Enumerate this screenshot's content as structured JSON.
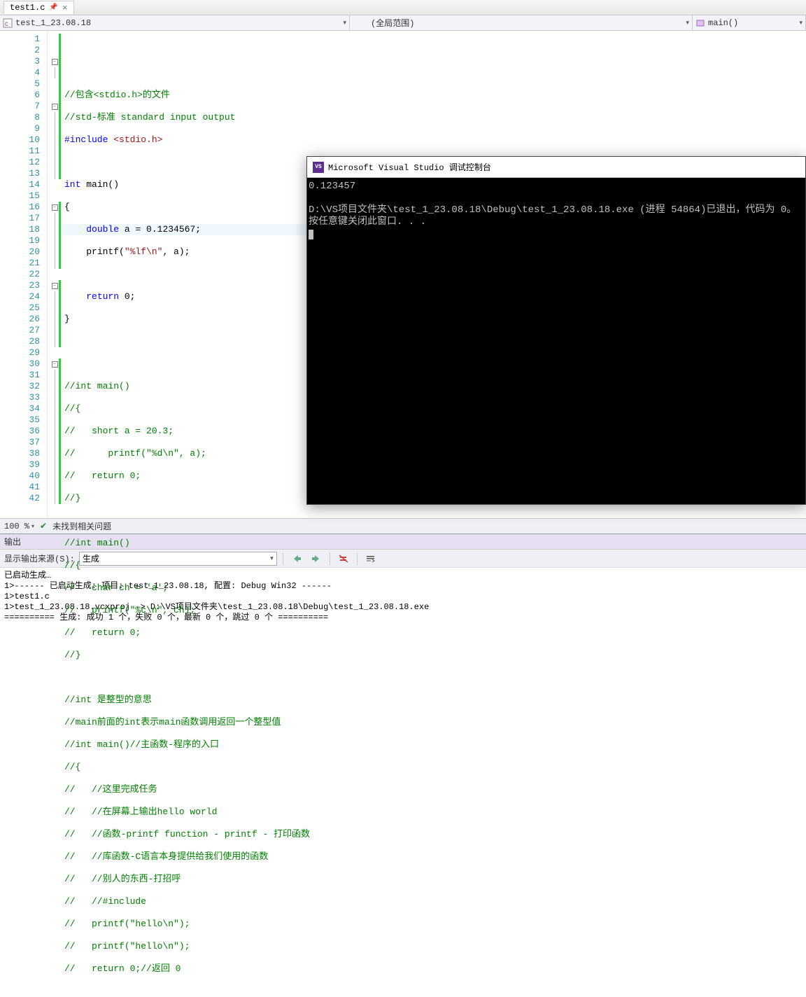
{
  "tab": {
    "filename": "test1.c"
  },
  "nav": {
    "file": "test_1_23.08.18",
    "scope": "(全局范围)",
    "func": "main()"
  },
  "code": {
    "lines": [
      "",
      "",
      "//包含<stdio.h>的文件",
      "//std-标准 standard input output",
      "#include <stdio.h>",
      "",
      "int main()",
      "{",
      "    double a = 0.1234567;",
      "    printf(\"%lf\\n\", a);",
      "",
      "    return 0;",
      "}",
      "",
      "",
      "//int main()",
      "//{",
      "//   short a = 20.3;",
      "//      printf(\"%d\\n\", a);",
      "//   return 0;",
      "//}",
      "",
      "//int main()",
      "//{",
      "//   char ch = 'a';",
      "//   printf(\"%c\\n\", ch);",
      "//   return 0;",
      "//}",
      "",
      "//int 是整型的意思",
      "//main前面的int表示main函数调用返回一个整型值",
      "//int main()//主函数-程序的入口",
      "//{",
      "//   //这里完成任务",
      "//   //在屏幕上输出hello world",
      "//   //函数-printf function - printf - 打印函数",
      "//   //库函数-C语言本身提供给我们使用的函数",
      "//   //别人的东西-打招呼",
      "//   //#include",
      "//   printf(\"hello\\n\");",
      "//   printf(\"hello\\n\");",
      "//   return 0;//返回 0"
    ]
  },
  "status": {
    "zoom": "100 %",
    "issues": "未找到相关问题"
  },
  "output": {
    "panel_title": "输出",
    "source_label": "显示输出来源(S):",
    "source_value": "生成",
    "body": "已启动生成…\n1>------ 已启动生成: 项目: test_1_23.08.18, 配置: Debug Win32 ------\n1>test1.c\n1>test_1_23.08.18.vcxproj -> D:\\VS项目文件夹\\test_1_23.08.18\\Debug\\test_1_23.08.18.exe\n========== 生成: 成功 1 个，失败 0 个，最新 0 个，跳过 0 个 =========="
  },
  "console": {
    "title": "Microsoft Visual Studio 调试控制台",
    "line1": "0.123457",
    "line2": "",
    "line3": "D:\\VS项目文件夹\\test_1_23.08.18\\Debug\\test_1_23.08.18.exe (进程 54864)已退出，代码为 0。",
    "line4": "按任意键关闭此窗口. . ."
  }
}
